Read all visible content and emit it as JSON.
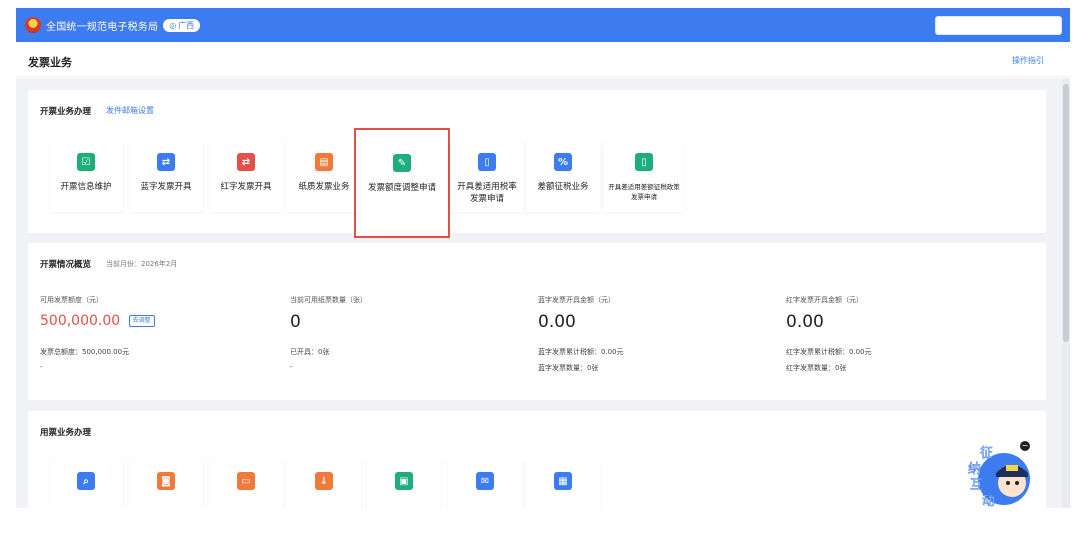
{
  "header": {
    "site_title": "全国统一规范电子税务局",
    "region": "广西",
    "search_placeholder": ""
  },
  "page": {
    "title": "发票业务",
    "guide_link": "操作指引"
  },
  "issuing": {
    "title": "开票业务办理",
    "link": "发件邮箱设置",
    "tiles": [
      {
        "label": "开票信息维护",
        "icon": "doc-check-icon",
        "color": "#1fae79"
      },
      {
        "label": "蓝字发票开具",
        "icon": "arrows-icon",
        "color": "#3d7cf0"
      },
      {
        "label": "红字发票开具",
        "icon": "arrows-icon",
        "color": "#e2504a"
      },
      {
        "label": "纸质发票业务",
        "icon": "paper-ticket-icon",
        "color": "#ef7a3a"
      },
      {
        "label": "发票额度调整申请",
        "icon": "edit-doc-icon",
        "color": "#1fae79"
      },
      {
        "label": "开具差适用税率发票申请",
        "icon": "doc-icon",
        "color": "#3d7cf0"
      },
      {
        "label": "差额征税业务",
        "icon": "percent-doc-icon",
        "color": "#3d7cf0"
      },
      {
        "label": "开具差适用差额征税政策发票申请",
        "icon": "doc-icon",
        "color": "#1fae79"
      }
    ]
  },
  "overview": {
    "title": "开票情况概览",
    "month_note": "当前月份：2026年2月",
    "stats": [
      {
        "label": "可用发票额度（元）",
        "value": "500,000.00",
        "button": "去调整",
        "sub1": "发票总额度：500,000.00元",
        "sub2": "-"
      },
      {
        "label": "当前可用纸票数量（张）",
        "value": "0",
        "sub1": "已开具：0张",
        "sub2": "-"
      },
      {
        "label": "蓝字发票开具金额（元）",
        "value": "0.00",
        "sub1": "蓝字发票累计税额：0.00元",
        "sub2": "蓝字发票数量：0张"
      },
      {
        "label": "红字发票开具金额（元）",
        "value": "0.00",
        "sub1": "红字发票累计税额：0.00元",
        "sub2": "红字发票数量：0张"
      }
    ]
  },
  "usage": {
    "title": "用票业务办理",
    "tiles": [
      {
        "icon": "search-doc-icon",
        "color": "#3d7cf0"
      },
      {
        "icon": "ticket-icon",
        "color": "#ef7a3a"
      },
      {
        "icon": "ticket-tag-icon",
        "color": "#ef7a3a"
      },
      {
        "icon": "download-doc-icon",
        "color": "#ef7a3a"
      },
      {
        "icon": "calc-icon",
        "color": "#1fae79"
      },
      {
        "icon": "mail-icon",
        "color": "#3d7cf0"
      },
      {
        "icon": "grid-icon",
        "color": "#3d7cf0"
      }
    ]
  },
  "helper": {
    "chars": [
      "征",
      "纳",
      "互",
      "动"
    ]
  }
}
